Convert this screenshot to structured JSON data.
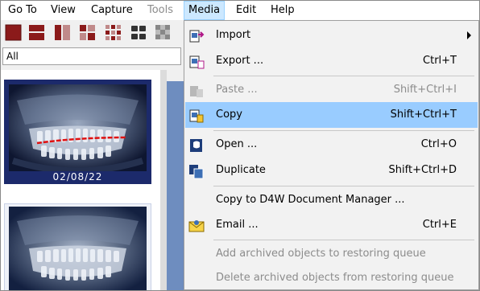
{
  "menubar": {
    "items": [
      {
        "label": "Go To"
      },
      {
        "label": "View"
      },
      {
        "label": "Capture"
      },
      {
        "label": "Tools"
      },
      {
        "label": "Media"
      },
      {
        "label": "Edit"
      },
      {
        "label": "Help"
      }
    ]
  },
  "filter": {
    "value": "All"
  },
  "thumbnails": [
    {
      "date": "02/08/22",
      "selected": true
    },
    {
      "selected": false
    }
  ],
  "media_menu": {
    "items": [
      {
        "label": "Import",
        "shortcut": "",
        "icon": "import-icon",
        "submenu": true
      },
      {
        "label": "Export ...",
        "shortcut": "Ctrl+T",
        "icon": "export-icon"
      },
      {
        "label": "Paste ...",
        "shortcut": "Shift+Ctrl+I",
        "icon": "paste-icon",
        "disabled": true
      },
      {
        "label": "Copy",
        "shortcut": "Shift+Ctrl+T",
        "icon": "copy-icon",
        "highlighted": true
      },
      {
        "label": "Open ...",
        "shortcut": "Ctrl+O",
        "icon": "open-icon"
      },
      {
        "label": "Duplicate",
        "shortcut": "Shift+Ctrl+D",
        "icon": "duplicate-icon"
      },
      {
        "label": "Copy to D4W Document Manager ...",
        "shortcut": ""
      },
      {
        "label": "Email ...",
        "shortcut": "Ctrl+E",
        "icon": "email-icon"
      },
      {
        "label": "Add archived objects to restoring queue",
        "shortcut": "",
        "disabled": true
      },
      {
        "label": "Delete archived objects from restoring queue",
        "shortcut": "",
        "disabled": true
      }
    ]
  },
  "colors": {
    "highlight": "#99ccff",
    "selection_border": "#1c2a6b",
    "toolbar_red": "#8b1a1a"
  }
}
